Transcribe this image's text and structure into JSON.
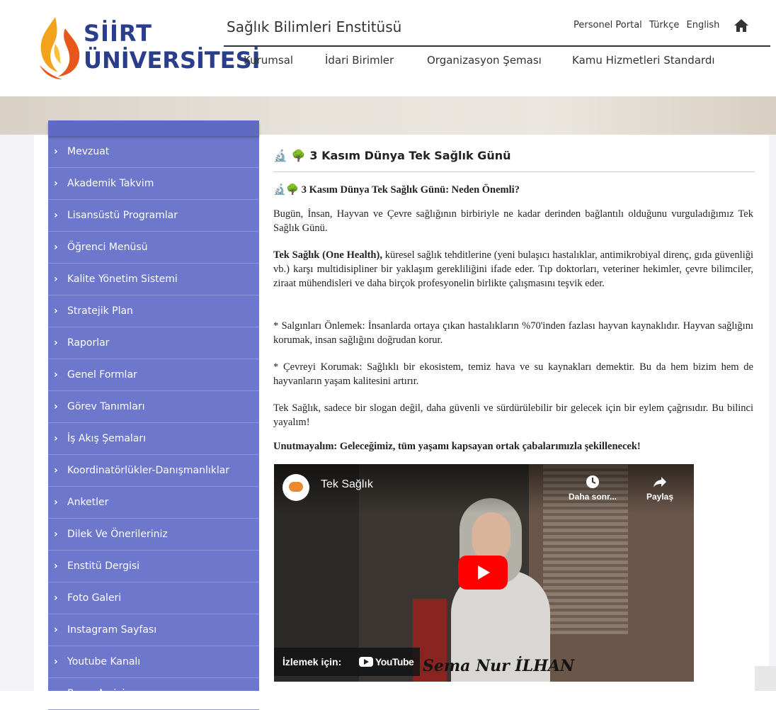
{
  "header": {
    "logo_line1": "SİİRT",
    "logo_line2": "ÜNİVERSİTESİ",
    "site_title": "Sağlık Bilimleri Enstitüsü",
    "top_links": [
      "Personel Portal",
      "Türkçe",
      "English"
    ],
    "nav": [
      "Kurumsal",
      "İdari Birimler",
      "Organizasyon Şeması",
      "Kamu Hizmetleri Standardı"
    ]
  },
  "sidebar": {
    "items": [
      "Mevzuat",
      "Akademik Takvim",
      "Lisansüstü Programlar",
      "Öğrenci Menüsü",
      "Kalite Yönetim Sistemi",
      "Stratejik Plan",
      "Raporlar",
      "Genel Formlar",
      "Görev Tanımları",
      "İş Akış Şemaları",
      "Koordinatörlükler-Danışmanlıklar",
      "Anketler",
      "Dilek Ve Önerileriniz",
      "Enstitü Dergisi",
      "Foto Galeri",
      "Instagram Sayfası",
      "Youtube Kanalı",
      "Basın Arşivi"
    ]
  },
  "article": {
    "title_icons": "🔬 🌳",
    "title": "3 Kasım Dünya Tek Sağlık Günü",
    "subtitle_icons": "🔬🌳",
    "subtitle": "3 Kasım Dünya Tek Sağlık Günü: Neden Önemli?",
    "p1": "Bugün, İnsan, Hayvan ve Çevre sağlığının birbiriyle ne kadar derinden bağlantılı olduğunu vurguladığımız Tek Sağlık Günü.",
    "p2_bold": "Tek Sağlık (One Health),",
    "p2_rest": " küresel sağlık tehditlerine (yeni bulaşıcı hastalıklar, antimikrobiyal direnç, gıda güvenliği vb.) karşı multidisipliner bir yaklaşım gerekliliğini ifade eder. Tıp doktorları, veteriner hekimler, çevre bilimciler, ziraat mühendisleri ve daha birçok profesyonelin birlikte çalışmasını teşvik eder.",
    "p3": " * Salgınları Önlemek: İnsanlarda ortaya çıkan hastalıkların %70'inden fazlası hayvan kaynaklıdır. Hayvan sağlığını korumak, insan sağlığını doğrudan korur.",
    "p4": " * Çevreyi Korumak: Sağlıklı bir ekosistem, temiz hava ve su kaynakları demektir. Bu da hem bizim hem de hayvanların yaşam kalitesini artırır.",
    "p5": "Tek Sağlık, sadece bir slogan değil, daha güvenli ve sürdürülebilir bir gelecek için bir eylem çağrısıdır. Bu bilinci yayalım!",
    "p6": "Unutmayalım: Geleceğimiz, tüm yaşamı kapsayan ortak çabalarımızla şekillenecek!"
  },
  "video": {
    "title": "Tek Sağlık",
    "watch_later": "Daha sonr...",
    "share": "Paylaş",
    "watch_on": "İzlemek için:",
    "youtube": "YouTube",
    "signature": "Sema Nur İLHAN"
  },
  "colors": {
    "sidebar": "#6d78cc",
    "logo_text": "#2b3e8c",
    "youtube_red": "#ff0000"
  }
}
